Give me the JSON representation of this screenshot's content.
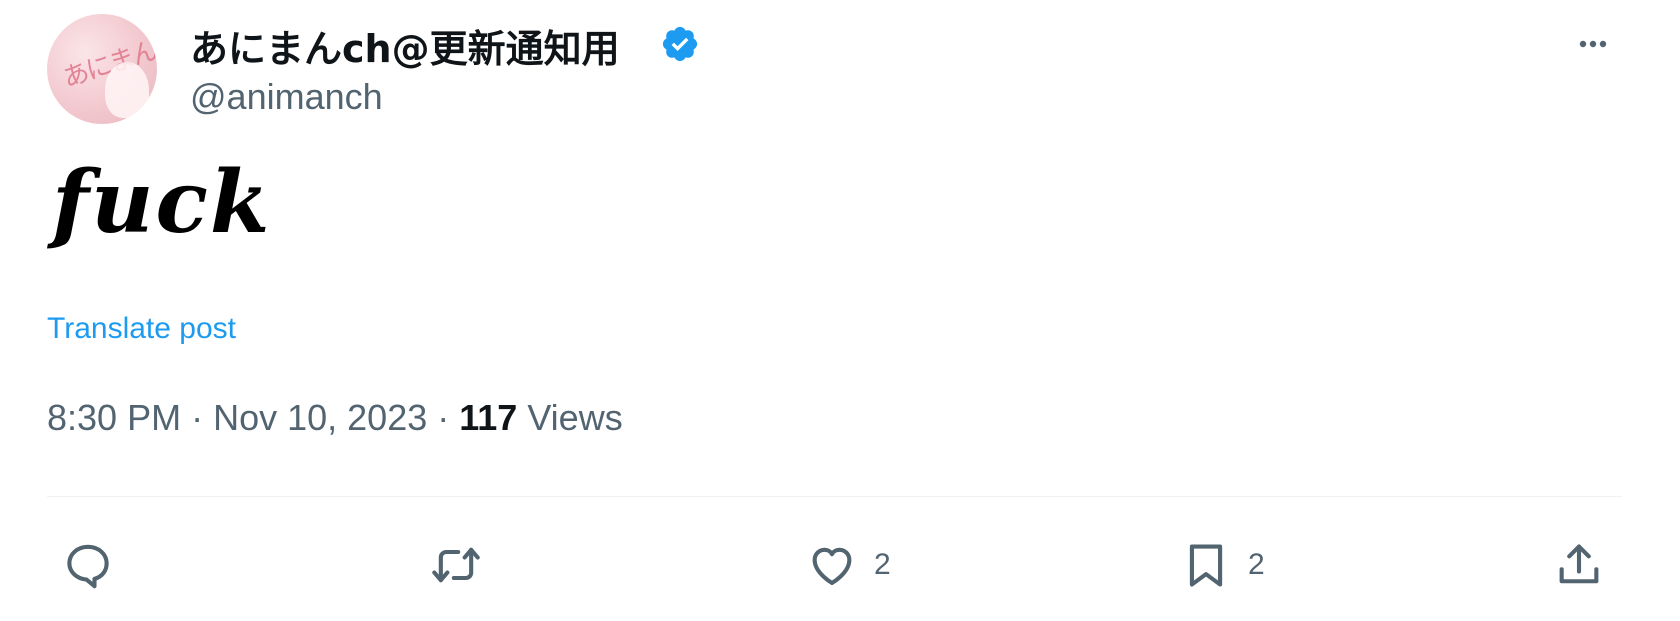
{
  "author": {
    "display_name": "あにまんch@更新通知用",
    "handle": "@animanch",
    "verified": true,
    "avatar_icon": "avatar-image",
    "badge_icon": "verified-badge-icon",
    "badge_color": "#1d9bf0"
  },
  "post": {
    "text": "𝒇𝒖𝒄𝒌"
  },
  "translate": {
    "label": "Translate post",
    "color": "#1d9bf0"
  },
  "meta": {
    "time": "8:30 PM",
    "separator": " · ",
    "date": "Nov 10, 2023",
    "views_count": "117",
    "views_label": " Views"
  },
  "actions": {
    "reply": {
      "icon": "reply-icon",
      "count": ""
    },
    "repost": {
      "icon": "repost-icon",
      "count": ""
    },
    "like": {
      "icon": "heart-icon",
      "count": "2"
    },
    "bookmark": {
      "icon": "bookmark-icon",
      "count": "2"
    },
    "share": {
      "icon": "share-icon",
      "count": ""
    }
  },
  "colors": {
    "text_primary": "#0f1419",
    "text_secondary": "#536471",
    "divider": "#eff3f4"
  }
}
